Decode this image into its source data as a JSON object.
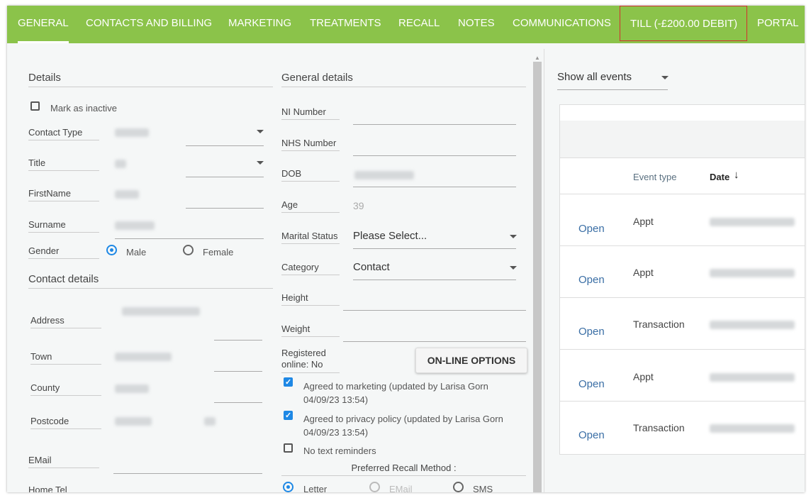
{
  "tabs": [
    {
      "label": "GENERAL"
    },
    {
      "label": "CONTACTS AND BILLING"
    },
    {
      "label": "MARKETING"
    },
    {
      "label": "TREATMENTS"
    },
    {
      "label": "RECALL"
    },
    {
      "label": "NOTES"
    },
    {
      "label": "COMMUNICATIONS"
    },
    {
      "label": "TILL (-£200.00 DEBIT)"
    },
    {
      "label": "PORTAL"
    }
  ],
  "details": {
    "section_title": "Details",
    "mark_inactive": "Mark as inactive",
    "contact_type_label": "Contact Type",
    "title_label": "Title",
    "firstname_label": "FirstName",
    "surname_label": "Surname",
    "gender_label": "Gender",
    "gender_male": "Male",
    "gender_female": "Female"
  },
  "contact_details": {
    "section_title": "Contact details",
    "address_label": "Address",
    "town_label": "Town",
    "county_label": "County",
    "postcode_label": "Postcode",
    "email_label": "EMail",
    "home_tel_label": "Home Tel"
  },
  "general_details": {
    "section_title": "General details",
    "ni_label": "NI Number",
    "nhs_label": "NHS Number",
    "dob_label": "DOB",
    "age_label": "Age",
    "age_value": "39",
    "marital_label": "Marital Status",
    "marital_value": "Please Select...",
    "category_label": "Category",
    "category_value": "Contact",
    "height_label": "Height",
    "weight_label": "Weight",
    "registered_label_1": "Registered",
    "registered_label_2": "online: No",
    "online_options_button": "ON-LINE OPTIONS",
    "marketing_line1": "Agreed to marketing (updated by Larisa Gorn",
    "marketing_line2": "04/09/23 13:54)",
    "privacy_line1": "Agreed to privacy policy (updated by Larisa Gorn",
    "privacy_line2": "04/09/23 13:54)",
    "no_text_reminders": "No text reminders",
    "recall_method_label": "Preferred Recall Method :",
    "recall_letter": "Letter",
    "recall_email": "EMail",
    "recall_sms": "SMS"
  },
  "events": {
    "filter_value": "Show all events",
    "col_event_type": "Event type",
    "col_date": "Date",
    "rows": [
      {
        "open": "Open",
        "type": "Appt"
      },
      {
        "open": "Open",
        "type": "Appt"
      },
      {
        "open": "Open",
        "type": "Transaction"
      },
      {
        "open": "Open",
        "type": "Appt"
      },
      {
        "open": "Open",
        "type": "Transaction"
      }
    ]
  }
}
